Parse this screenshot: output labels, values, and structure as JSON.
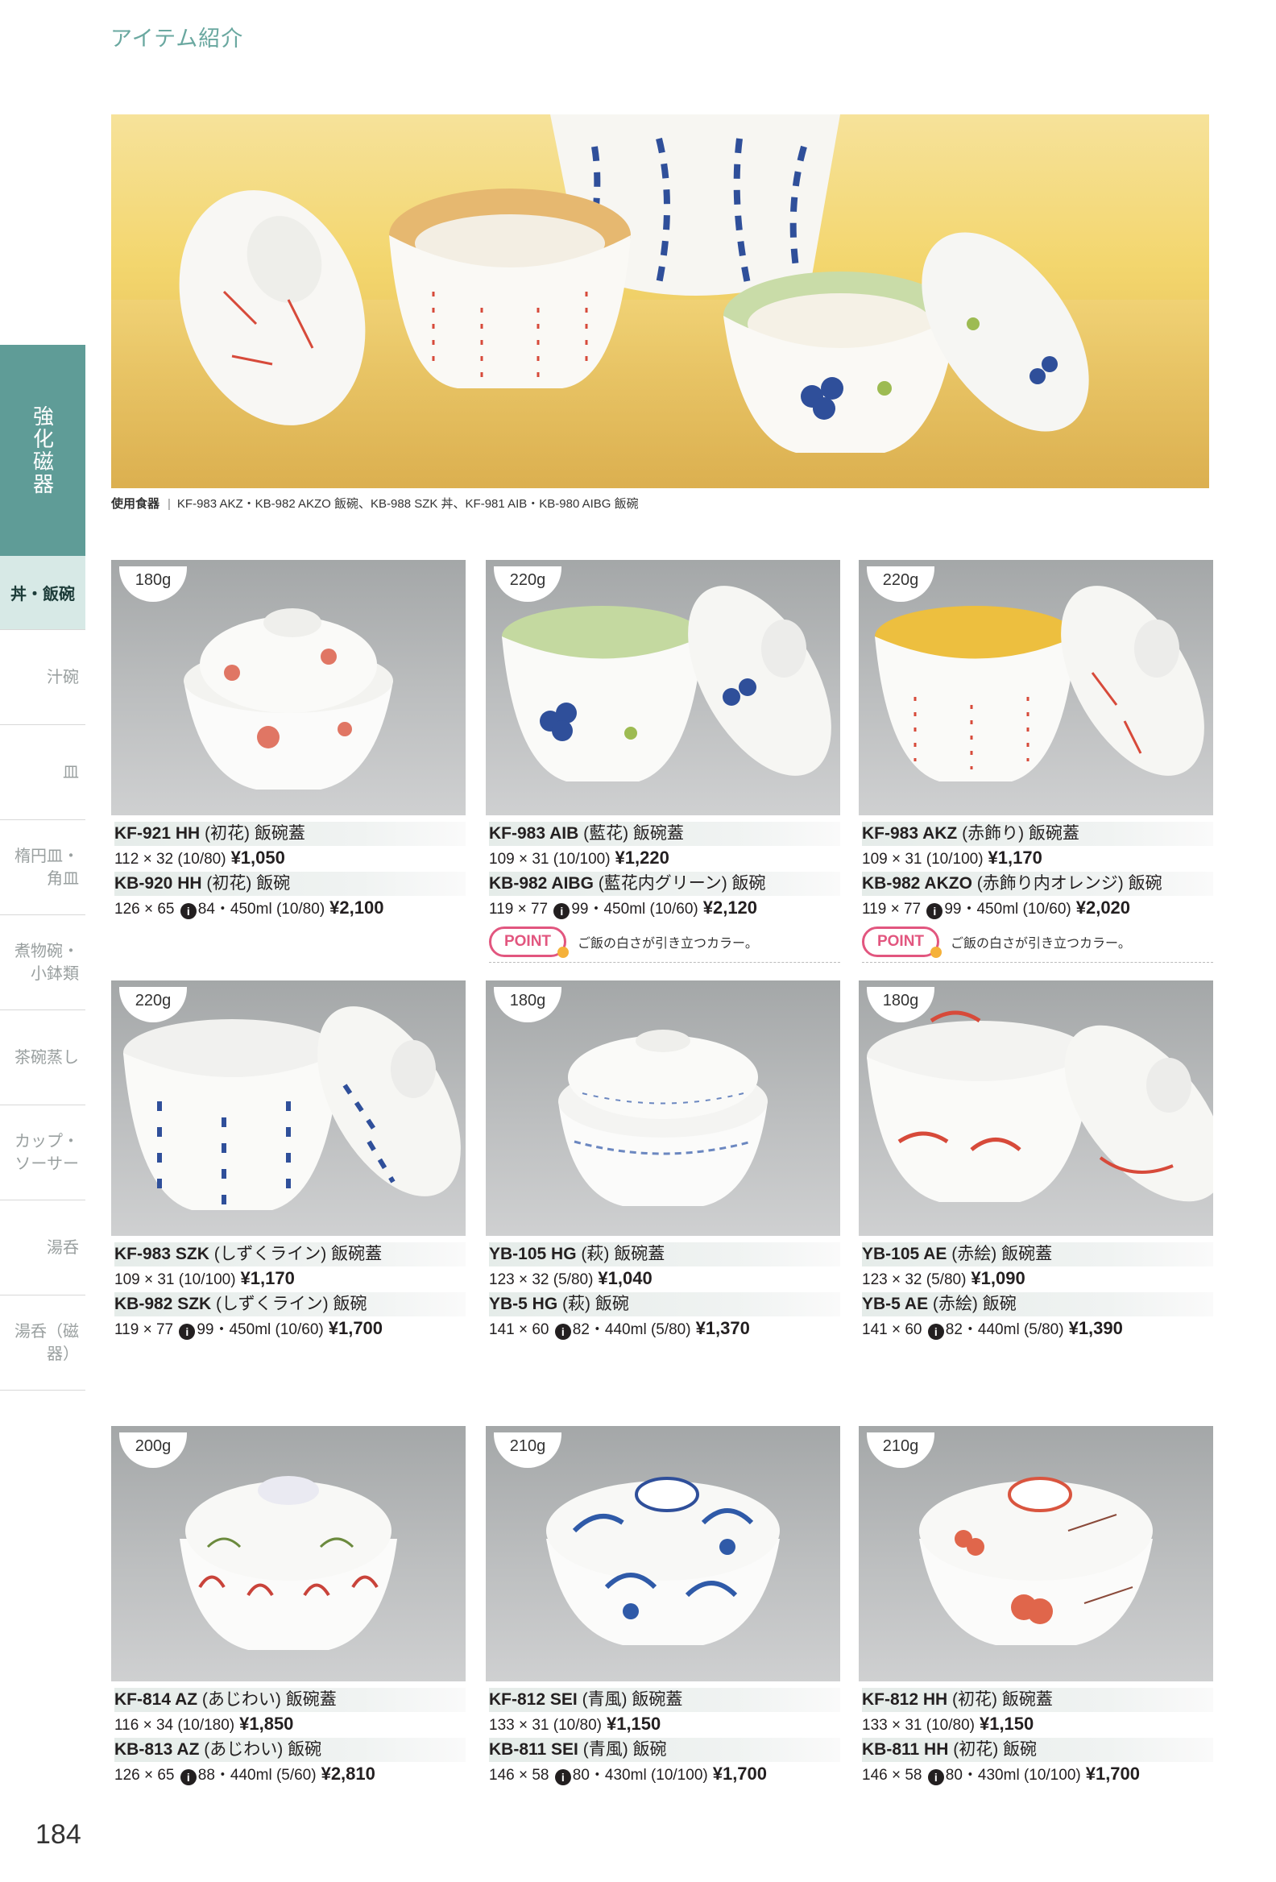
{
  "header": {
    "title": "アイテム紹介"
  },
  "hero": {
    "caption_label": "使用食器",
    "caption_sep": "|",
    "caption_text": "KF-983 AKZ・KB-982 AKZO 飯碗、KB-988 SZK 丼、KF-981 AIB・KB-980 AIBG 飯碗"
  },
  "sidebar": {
    "main": "強化磁器",
    "active": "丼・飯碗",
    "items": [
      "汁碗",
      "皿",
      "楕円皿・角皿",
      "煮物碗・小鉢類",
      "茶碗蒸し",
      "カップ・ソーサー",
      "湯呑",
      "湯呑（磁器）"
    ]
  },
  "page_number": "184",
  "colors": {
    "accent": "#5f9c97",
    "point": "#e2567f",
    "photo_bg": "#b8babb"
  },
  "products": [
    {
      "weight": "180g",
      "l1_code": "KF-921 HH",
      "l1_desc": "(初花) 飯碗蓋",
      "l1_dims": "112 × 32 (10/80)",
      "l1_price": "¥1,050",
      "l2_code": "KB-920 HH",
      "l2_desc": "(初花) 飯碗",
      "l2_dims": "126 × 65",
      "l2_cap": "84・450ml (10/80)",
      "l2_price": "¥2,100"
    },
    {
      "weight": "220g",
      "l1_code": "KF-983 AIB",
      "l1_desc": "(藍花) 飯碗蓋",
      "l1_dims": "109 × 31 (10/100)",
      "l1_price": "¥1,220",
      "l2_code": "KB-982 AIBG",
      "l2_desc": "(藍花内グリーン) 飯碗",
      "l2_dims": "119 × 77",
      "l2_cap": "99・450ml (10/60)",
      "l2_price": "¥2,120",
      "point": "POINT",
      "point_text": "ご飯の白さが引き立つカラー。"
    },
    {
      "weight": "220g",
      "l1_code": "KF-983 AKZ",
      "l1_desc": "(赤飾り) 飯碗蓋",
      "l1_dims": "109 × 31 (10/100)",
      "l1_price": "¥1,170",
      "l2_code": "KB-982 AKZO",
      "l2_desc": "(赤飾り内オレンジ) 飯碗",
      "l2_dims": "119 × 77",
      "l2_cap": "99・450ml (10/60)",
      "l2_price": "¥2,020",
      "point": "POINT",
      "point_text": "ご飯の白さが引き立つカラー。"
    },
    {
      "weight": "220g",
      "l1_code": "KF-983 SZK",
      "l1_desc": "(しずくライン) 飯碗蓋",
      "l1_dims": "109 × 31 (10/100)",
      "l1_price": "¥1,170",
      "l2_code": "KB-982 SZK",
      "l2_desc": "(しずくライン) 飯碗",
      "l2_dims": "119 × 77",
      "l2_cap": "99・450ml (10/60)",
      "l2_price": "¥1,700"
    },
    {
      "weight": "180g",
      "l1_code": "YB-105 HG",
      "l1_desc": "(萩) 飯碗蓋",
      "l1_dims": "123 × 32 (5/80)",
      "l1_price": "¥1,040",
      "l2_code": "YB-5 HG",
      "l2_desc": "(萩) 飯碗",
      "l2_dims": "141 × 60",
      "l2_cap": "82・440ml (5/80)",
      "l2_price": "¥1,370"
    },
    {
      "weight": "180g",
      "l1_code": "YB-105 AE",
      "l1_desc": "(赤絵) 飯碗蓋",
      "l1_dims": "123 × 32 (5/80)",
      "l1_price": "¥1,090",
      "l2_code": "YB-5 AE",
      "l2_desc": "(赤絵) 飯碗",
      "l2_dims": "141 × 60",
      "l2_cap": "82・440ml (5/80)",
      "l2_price": "¥1,390"
    },
    {
      "weight": "200g",
      "l1_code": "KF-814 AZ",
      "l1_desc": "(あじわい) 飯碗蓋",
      "l1_dims": "116 × 34 (10/180)",
      "l1_price": "¥1,850",
      "l2_code": "KB-813 AZ",
      "l2_desc": "(あじわい) 飯碗",
      "l2_dims": "126 × 65",
      "l2_cap": "88・440ml (5/60)",
      "l2_price": "¥2,810"
    },
    {
      "weight": "210g",
      "l1_code": "KF-812 SEI",
      "l1_desc": "(青風) 飯碗蓋",
      "l1_dims": "133 × 31 (10/80)",
      "l1_price": "¥1,150",
      "l2_code": "KB-811 SEI",
      "l2_desc": "(青風) 飯碗",
      "l2_dims": "146 × 58",
      "l2_cap": "80・430ml (10/100)",
      "l2_price": "¥1,700"
    },
    {
      "weight": "210g",
      "l1_code": "KF-812 HH",
      "l1_desc": "(初花) 飯碗蓋",
      "l1_dims": "133 × 31 (10/80)",
      "l1_price": "¥1,150",
      "l2_code": "KB-811 HH",
      "l2_desc": "(初花) 飯碗",
      "l2_dims": "146 × 58",
      "l2_cap": "80・430ml (10/100)",
      "l2_price": "¥1,700"
    }
  ]
}
